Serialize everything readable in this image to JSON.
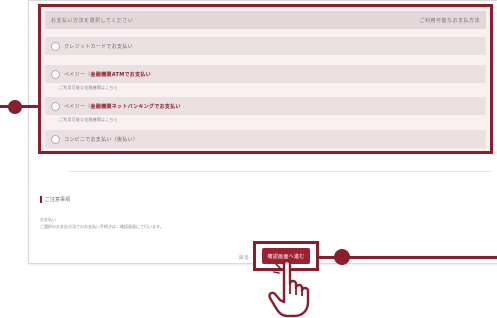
{
  "options_panel": {
    "header_left": "お支払い方法を選択してください",
    "header_right": "ご利用可能なお支払方法",
    "items": [
      {
        "label": "クレジットカードでお支払い",
        "strong": "",
        "sub": ""
      },
      {
        "label": "ペイジー（",
        "strong": "金融機関ATMでお支払い",
        "sub": "ご利用可能な金融機関はこちら"
      },
      {
        "label": "ペイジー（",
        "strong": "金融機関ネットバンキングでお支払い",
        "sub": "ご利用可能な金融機関はこちら"
      },
      {
        "label": "コンビニでお支払い（後払い）",
        "strong": "",
        "sub": ""
      }
    ]
  },
  "remarks": {
    "title": "ご注意事項",
    "line1": "お支払い",
    "line2": "ご選択のお支払方法でのお支払い手続きは、確認画面にて行います。"
  },
  "actions": {
    "back_label": "戻る",
    "confirm_label": "確認画面へ進む"
  },
  "colors": {
    "accent": "#8b1e2c",
    "button": "#9c2233"
  },
  "icons": {
    "pointer": "pointing-hand-icon"
  }
}
